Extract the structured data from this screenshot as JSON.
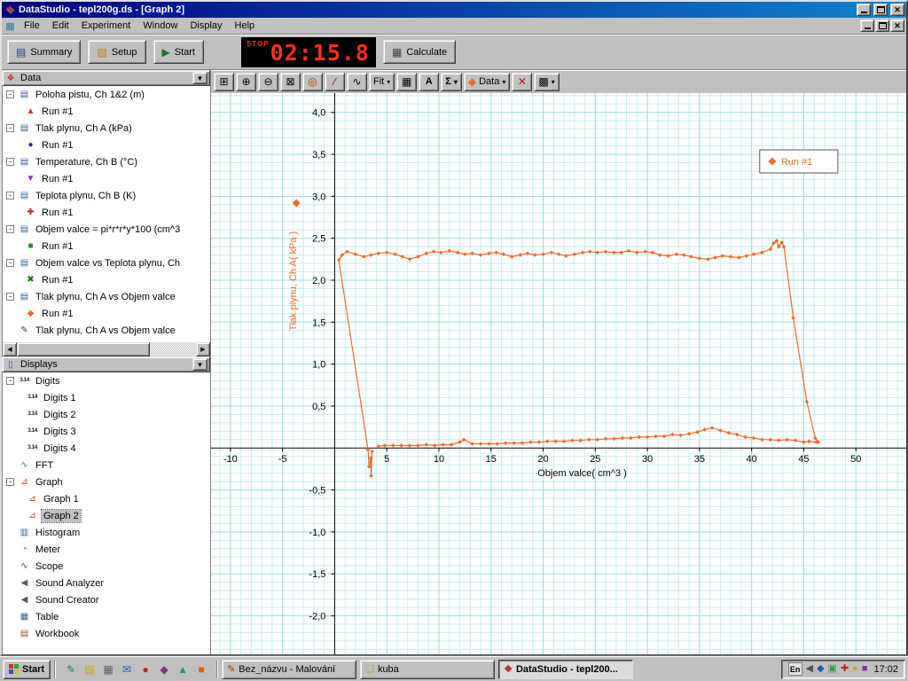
{
  "window": {
    "title": "DataStudio - tepl200g.ds - [Graph 2]"
  },
  "menu": {
    "items": [
      "File",
      "Edit",
      "Experiment",
      "Window",
      "Display",
      "Help"
    ]
  },
  "toolbar": {
    "summary_label": "Summary",
    "setup_label": "Setup",
    "start_label": "Start",
    "stop_label": "STOP",
    "timer_value": "02:15.8",
    "calculate_label": "Calculate"
  },
  "graph_toolbar": {
    "buttons": [
      {
        "name": "scale-to-fit-button",
        "icon": "scale-to-fit"
      },
      {
        "name": "zoom-in-button",
        "icon": "zoom-in"
      },
      {
        "name": "zoom-out-button",
        "icon": "zoom-out"
      },
      {
        "name": "zoom-select-button",
        "icon": "zoom-select"
      },
      {
        "name": "smart-tool-button",
        "icon": "smart-tool"
      },
      {
        "name": "slope-tool-button",
        "icon": "slope-tool"
      },
      {
        "name": "fit-line-tool-button",
        "icon": "fit-line-tool"
      },
      {
        "name": "fit-menu-button",
        "label": "Fit",
        "caret": true
      },
      {
        "name": "calculator-button",
        "icon": "calculator"
      },
      {
        "name": "text-tool-button",
        "label": "A"
      },
      {
        "name": "statistics-menu-button",
        "label": "Σ",
        "caret": true
      },
      {
        "name": "data-menu-button",
        "icon": "data-diamond",
        "label": "Data",
        "caret": true
      },
      {
        "name": "delete-button",
        "icon": "delete"
      },
      {
        "name": "graph-options-menu-button",
        "icon": "graph-options",
        "caret": true
      }
    ]
  },
  "data_panel": {
    "header": "Data",
    "sources": [
      {
        "label": "Poloha pistu, Ch 1&2 (m)",
        "marker": "triangle-up",
        "marker_color": "#e03030",
        "runs": [
          "Run #1"
        ]
      },
      {
        "label": "Tlak plynu, Ch A (kPa)",
        "marker": "circle",
        "marker_color": "#2020d0",
        "runs": [
          "Run #1"
        ]
      },
      {
        "label": "Temperature, Ch B (°C)",
        "marker": "triangle-down",
        "marker_color": "#9030b0",
        "runs": [
          "Run #1"
        ]
      },
      {
        "label": "Teplota plynu, Ch B (K)",
        "marker": "plus",
        "marker_color": "#c02020",
        "runs": [
          "Run #1"
        ]
      },
      {
        "label": "Objem valce = pi*r*r*y*100 (cm^3",
        "marker": "square",
        "marker_color": "#209020",
        "runs": [
          "Run #1"
        ]
      },
      {
        "label": "Objem valce vs Teplota plynu, Ch",
        "marker": "x",
        "marker_color": "#107010",
        "runs": [
          "Run #1"
        ]
      },
      {
        "label": "Tlak plynu, Ch A vs Objem valce",
        "marker": "diamond",
        "marker_color": "#f06a28",
        "runs": [
          "Run #1"
        ]
      },
      {
        "label": "Tlak plynu, Ch A vs Objem valce",
        "marker": "pencil",
        "marker_color": "#404040",
        "runs": []
      }
    ],
    "run_label": "Run #1"
  },
  "displays_panel": {
    "header": "Displays",
    "items": [
      {
        "label": "Digits",
        "icon": "digits",
        "children": [
          "Digits 1",
          "Digits 2",
          "Digits 3",
          "Digits 4"
        ]
      },
      {
        "label": "FFT",
        "icon": "fft",
        "children": []
      },
      {
        "label": "Graph",
        "icon": "graph",
        "children": [
          "Graph 1",
          "Graph 2"
        ],
        "selected_child": "Graph 2"
      },
      {
        "label": "Histogram",
        "icon": "histogram",
        "children": []
      },
      {
        "label": "Meter",
        "icon": "meter",
        "children": []
      },
      {
        "label": "Scope",
        "icon": "scope",
        "children": []
      },
      {
        "label": "Sound Analyzer",
        "icon": "sound",
        "children": []
      },
      {
        "label": "Sound Creator",
        "icon": "sound",
        "children": []
      },
      {
        "label": "Table",
        "icon": "table",
        "children": []
      },
      {
        "label": "Workbook",
        "icon": "workbook",
        "children": []
      }
    ]
  },
  "chart_data": {
    "type": "scatter",
    "title": "",
    "xlabel": "Objem valce( cm^3 )",
    "ylabel": "Tlak plynu, Ch A( kPa )",
    "xlim": [
      -11.86,
      54.83
    ],
    "ylim": [
      -2.46,
      4.23
    ],
    "x_ticks": [
      -10,
      -5,
      5,
      10,
      15,
      20,
      25,
      30,
      35,
      40,
      45,
      50
    ],
    "x_tick_labels": [
      "-10",
      "-5",
      "5",
      "10",
      "15",
      "20",
      "25",
      "30",
      "35",
      "40",
      "45",
      "50"
    ],
    "y_ticks": [
      4.0,
      3.5,
      3.0,
      2.5,
      2.0,
      1.5,
      1.0,
      0.5,
      -0.5,
      -1.0,
      -1.5,
      -2.0
    ],
    "y_tick_labels": [
      "4,0",
      "3,5",
      "3,0",
      "2,5",
      "2,0",
      "1,5",
      "1,0",
      "0,5",
      "-0,5",
      "-1,0",
      "-1,5",
      "-2,0"
    ],
    "grid": true,
    "grid_minor_color": "#c6eef0",
    "grid_major_color": "#93dde1",
    "legend": {
      "label": "Run #1",
      "position": "top-right"
    },
    "series_color": "#f06a28",
    "series": [
      {
        "name": "Run #1",
        "points": [
          [
            3.6,
            -0.04
          ],
          [
            3.5,
            -0.33
          ],
          [
            3.45,
            -0.12
          ],
          [
            3.3,
            -0.22
          ],
          [
            3.2,
            -0.02
          ],
          [
            0.4,
            2.24
          ],
          [
            0.7,
            2.3
          ],
          [
            1.2,
            2.34
          ],
          [
            2,
            2.31
          ],
          [
            2.8,
            2.28
          ],
          [
            3.5,
            2.3
          ],
          [
            4.2,
            2.32
          ],
          [
            5,
            2.33
          ],
          [
            5.8,
            2.31
          ],
          [
            6.5,
            2.28
          ],
          [
            7.2,
            2.25
          ],
          [
            8,
            2.28
          ],
          [
            8.8,
            2.32
          ],
          [
            9.5,
            2.34
          ],
          [
            10.2,
            2.33
          ],
          [
            11,
            2.35
          ],
          [
            11.8,
            2.33
          ],
          [
            12.5,
            2.31
          ],
          [
            13.2,
            2.32
          ],
          [
            14,
            2.3
          ],
          [
            14.8,
            2.32
          ],
          [
            15.5,
            2.33
          ],
          [
            16.2,
            2.31
          ],
          [
            17,
            2.28
          ],
          [
            17.8,
            2.3
          ],
          [
            18.5,
            2.32
          ],
          [
            19.2,
            2.3
          ],
          [
            20,
            2.31
          ],
          [
            20.8,
            2.33
          ],
          [
            21.5,
            2.31
          ],
          [
            22.2,
            2.29
          ],
          [
            23,
            2.31
          ],
          [
            23.8,
            2.33
          ],
          [
            24.5,
            2.34
          ],
          [
            25.2,
            2.33
          ],
          [
            26,
            2.34
          ],
          [
            26.8,
            2.33
          ],
          [
            27.5,
            2.33
          ],
          [
            28.2,
            2.35
          ],
          [
            29,
            2.33
          ],
          [
            29.8,
            2.34
          ],
          [
            30.5,
            2.33
          ],
          [
            31.2,
            2.3
          ],
          [
            32,
            2.29
          ],
          [
            32.8,
            2.31
          ],
          [
            33.5,
            2.3
          ],
          [
            34.2,
            2.28
          ],
          [
            35,
            2.26
          ],
          [
            35.8,
            2.25
          ],
          [
            36.5,
            2.27
          ],
          [
            37.2,
            2.29
          ],
          [
            38,
            2.28
          ],
          [
            38.8,
            2.27
          ],
          [
            39.5,
            2.29
          ],
          [
            40.2,
            2.31
          ],
          [
            41,
            2.33
          ],
          [
            41.8,
            2.37
          ],
          [
            42.1,
            2.44
          ],
          [
            42.4,
            2.47
          ],
          [
            42.6,
            2.4
          ],
          [
            42.9,
            2.45
          ],
          [
            43.1,
            2.4
          ],
          [
            44,
            1.55
          ],
          [
            45.3,
            0.55
          ],
          [
            46.1,
            0.12
          ],
          [
            46.4,
            0.07
          ],
          [
            46.2,
            0.07
          ],
          [
            45.5,
            0.08
          ],
          [
            45,
            0.07
          ],
          [
            44.2,
            0.09
          ],
          [
            43.4,
            0.1
          ],
          [
            42.6,
            0.09
          ],
          [
            41.8,
            0.1
          ],
          [
            41,
            0.1
          ],
          [
            40.2,
            0.12
          ],
          [
            39.4,
            0.13
          ],
          [
            38.6,
            0.16
          ],
          [
            37.8,
            0.18
          ],
          [
            37,
            0.21
          ],
          [
            36.2,
            0.24
          ],
          [
            35.5,
            0.22
          ],
          [
            34.8,
            0.19
          ],
          [
            34,
            0.17
          ],
          [
            33.2,
            0.15
          ],
          [
            32.4,
            0.16
          ],
          [
            31.6,
            0.14
          ],
          [
            30.8,
            0.14
          ],
          [
            30,
            0.13
          ],
          [
            29.2,
            0.13
          ],
          [
            28.4,
            0.12
          ],
          [
            27.6,
            0.12
          ],
          [
            26.8,
            0.11
          ],
          [
            26,
            0.11
          ],
          [
            25.2,
            0.1
          ],
          [
            24.4,
            0.1
          ],
          [
            23.6,
            0.09
          ],
          [
            22.8,
            0.09
          ],
          [
            22,
            0.08
          ],
          [
            21.2,
            0.08
          ],
          [
            20.4,
            0.08
          ],
          [
            19.6,
            0.07
          ],
          [
            18.8,
            0.07
          ],
          [
            18,
            0.06
          ],
          [
            17.2,
            0.06
          ],
          [
            16.4,
            0.06
          ],
          [
            15.6,
            0.05
          ],
          [
            14.8,
            0.05
          ],
          [
            14,
            0.05
          ],
          [
            13.2,
            0.05
          ],
          [
            12.4,
            0.1
          ],
          [
            12,
            0.07
          ],
          [
            11.2,
            0.04
          ],
          [
            10.4,
            0.04
          ],
          [
            9.6,
            0.03
          ],
          [
            8.8,
            0.04
          ],
          [
            8,
            0.03
          ],
          [
            7.2,
            0.03
          ],
          [
            6.4,
            0.03
          ],
          [
            5.6,
            0.03
          ],
          [
            4.8,
            0.03
          ],
          [
            4.2,
            0.02
          ]
        ]
      }
    ]
  },
  "taskbar": {
    "start_label": "Start",
    "quick_launch": [
      {
        "name": "quick-launch-icon-1",
        "glyph": "✎",
        "color": "#207878"
      },
      {
        "name": "quick-launch-icon-2",
        "glyph": "▤",
        "color": "#c8a020"
      },
      {
        "name": "quick-launch-icon-3",
        "glyph": "▦",
        "color": "#606060"
      },
      {
        "name": "quick-launch-icon-4",
        "glyph": "✉",
        "color": "#2858b0"
      },
      {
        "name": "quick-launch-icon-5",
        "glyph": "●",
        "color": "#c02020"
      },
      {
        "name": "quick-launch-icon-6",
        "glyph": "◆",
        "color": "#803080"
      },
      {
        "name": "quick-launch-icon-7",
        "glyph": "▲",
        "color": "#28a050"
      },
      {
        "name": "quick-launch-icon-8",
        "glyph": "■",
        "color": "#e06000"
      }
    ],
    "tasks": [
      {
        "name": "paint-task-button",
        "label": "Bez_názvu - Malování",
        "icon_glyph": "✎",
        "icon_color": "#b03020",
        "active": false
      },
      {
        "name": "kuba-folder-task-button",
        "label": "kuba",
        "icon_glyph": "❏",
        "icon_color": "#c8a030",
        "active": false
      },
      {
        "name": "datastudio-task-button",
        "label": "DataStudio - tepl200...",
        "icon_glyph": "❖",
        "icon_color": "#c03030",
        "active": true
      }
    ],
    "tray": {
      "lang": "En",
      "icons": [
        {
          "name": "volume-tray-icon",
          "glyph": "◀",
          "color": "#505860"
        },
        {
          "name": "scheduler-tray-icon",
          "glyph": "◆",
          "color": "#2858b0"
        },
        {
          "name": "display-tray-icon",
          "glyph": "▣",
          "color": "#28a050"
        },
        {
          "name": "antivirus-tray-icon",
          "glyph": "✚",
          "color": "#d02020"
        },
        {
          "name": "update-tray-icon",
          "glyph": "●",
          "color": "#e0a020"
        },
        {
          "name": "firewall-tray-icon",
          "glyph": "■",
          "color": "#8030a0"
        }
      ],
      "clock": "17:02"
    }
  }
}
